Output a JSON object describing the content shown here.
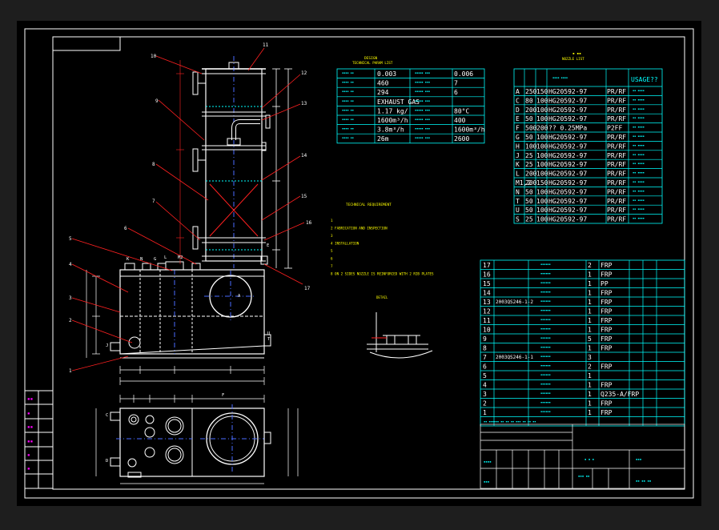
{
  "colors": {
    "background_outer": "#1e1e1e",
    "background_sheet": "#000000",
    "frame": "#ffffff",
    "cyan": "#00ffff",
    "red": "#ff2020",
    "yellow": "#ffff00",
    "white": "#ffffff",
    "blue": "#4a6cff",
    "magenta": "#ff00ff"
  },
  "design_param_table": {
    "title": "DESIGN",
    "subtitle": "TECHNICAL PARAM LIST",
    "rows": [
      {
        "l1": "",
        "v1": "0.003",
        "l2": "",
        "v2": "0.006"
      },
      {
        "l1": "",
        "v1": "460",
        "l2": "",
        "v2": "7"
      },
      {
        "l1": "",
        "v1": "294",
        "l2": "",
        "v2": "6"
      },
      {
        "l1": "",
        "v1": "EXHAUST GAS",
        "l2": "",
        "v2": ""
      },
      {
        "l1": "",
        "v1": "1.17 kg/",
        "l2": "",
        "v2": "80°C"
      },
      {
        "l1": "",
        "v1": "1600m³/h",
        "l2": "",
        "v2": "400"
      },
      {
        "l1": "",
        "v1": "3.8m³/h",
        "l2": "",
        "v2": "1600m³/h"
      },
      {
        "l1": "",
        "v1": "26m",
        "l2": "",
        "v2": "2600"
      }
    ]
  },
  "nozzle_table": {
    "title": "NOZZLE LIST",
    "usage": "USAGE??",
    "rows": [
      {
        "tag": "A",
        "dn": "250",
        "pn": "150",
        "std": "HG20592-97",
        "face": "PR/RF"
      },
      {
        "tag": "C",
        "dn": "80",
        "pn": "100",
        "std": "HG20592-97",
        "face": "PR/RF"
      },
      {
        "tag": "D",
        "dn": "200",
        "pn": "100",
        "std": "HG20592-97",
        "face": "PR/RF"
      },
      {
        "tag": "E",
        "dn": "50",
        "pn": "100",
        "std": "HG20592-97",
        "face": "PR/RF"
      },
      {
        "tag": "F",
        "dn": "500",
        "pn": "200",
        "std": "?? 0.25MPa",
        "face": "P2FF"
      },
      {
        "tag": "G",
        "dn": "50",
        "pn": "100",
        "std": "HG20592-97",
        "face": "PR/RF"
      },
      {
        "tag": "H",
        "dn": "100",
        "pn": "100",
        "std": "HG20592-97",
        "face": "PR/RF"
      },
      {
        "tag": "J",
        "dn": "25",
        "pn": "100",
        "std": "HG20592-97",
        "face": "PR/RF"
      },
      {
        "tag": "K",
        "dn": "25",
        "pn": "100",
        "std": "HG20592-97",
        "face": "PR/RF"
      },
      {
        "tag": "L",
        "dn": "200",
        "pn": "100",
        "std": "HG20592-97",
        "face": "PR/RF"
      },
      {
        "tag": "M1,2",
        "dn": "200",
        "pn": "150",
        "std": "HG20592-97",
        "face": "PR/RF"
      },
      {
        "tag": "N",
        "dn": "50",
        "pn": "100",
        "std": "HG20592-97",
        "face": "PR/RF"
      },
      {
        "tag": "T",
        "dn": "50",
        "pn": "100",
        "std": "HG20592-97",
        "face": "PR/RF"
      },
      {
        "tag": "U",
        "dn": "50",
        "pn": "100",
        "std": "HG20592-97",
        "face": "PR/RF"
      },
      {
        "tag": "S",
        "dn": "25",
        "pn": "100",
        "std": "HG20592-97",
        "face": "PR/RF"
      }
    ]
  },
  "tech_requirements": {
    "title": "TECHNICAL REQUIREMENT",
    "lines": [
      "1",
      "2  FABRICATION AND INSPECTION",
      "3",
      "4  INSTALLATION",
      "5",
      "6",
      "7",
      "8  ON 2 SIDES NOZZLE IS REINFORCED WITH 2 RIB PLATES"
    ]
  },
  "detail_note": "DETAIL",
  "bom": {
    "rows": [
      {
        "no": "17",
        "code": "",
        "qty": "2",
        "mat": "FRP"
      },
      {
        "no": "16",
        "code": "",
        "qty": "1",
        "mat": "FRP"
      },
      {
        "no": "15",
        "code": "",
        "qty": "1",
        "mat": "PP"
      },
      {
        "no": "14",
        "code": "",
        "qty": "1",
        "mat": "FRP"
      },
      {
        "no": "13",
        "code": "2003QS246-1-2",
        "qty": "1",
        "mat": "FRP"
      },
      {
        "no": "12",
        "code": "",
        "qty": "1",
        "mat": "FRP"
      },
      {
        "no": "11",
        "code": "",
        "qty": "1",
        "mat": "FRP"
      },
      {
        "no": "10",
        "code": "",
        "qty": "1",
        "mat": "FRP"
      },
      {
        "no": "9",
        "code": "",
        "qty": "5",
        "mat": "FRP"
      },
      {
        "no": "8",
        "code": "",
        "qty": "1",
        "mat": "FRP"
      },
      {
        "no": "7",
        "code": "2003QS246-1-1",
        "qty": "3",
        "mat": ""
      },
      {
        "no": "6",
        "code": "",
        "qty": "2",
        "mat": "FRP"
      },
      {
        "no": "5",
        "code": "",
        "qty": "1",
        "mat": ""
      },
      {
        "no": "4",
        "code": "",
        "qty": "1",
        "mat": "FRP"
      },
      {
        "no": "3",
        "code": "",
        "qty": "1",
        "mat": "Q235-A/FRP"
      },
      {
        "no": "2",
        "code": "",
        "qty": "1",
        "mat": "FRP"
      },
      {
        "no": "1",
        "code": "",
        "qty": "1",
        "mat": "FRP"
      }
    ]
  },
  "callouts": {
    "top": [
      "11",
      "10",
      "12",
      "13",
      "9",
      "14",
      "8",
      "15",
      "7",
      "16",
      "6",
      "5",
      "4",
      "3",
      "2",
      "1",
      "17"
    ]
  },
  "nozzle_marks": [
    "K",
    "N",
    "G",
    "L",
    "M2",
    "A",
    "F",
    "T",
    "U",
    "E",
    "J",
    "C",
    "D"
  ]
}
